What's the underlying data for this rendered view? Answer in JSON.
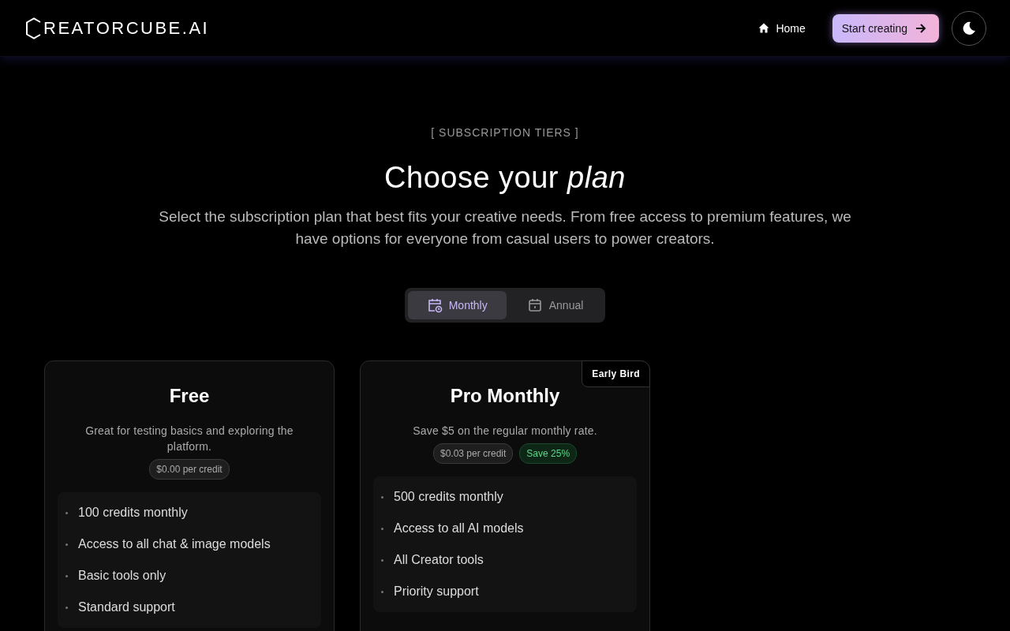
{
  "header": {
    "logo": "REATORCUBE.AI",
    "nav": [
      {
        "label": "Home"
      }
    ],
    "cta": "Start creating"
  },
  "hero": {
    "eyebrow": "[ SUBSCRIPTION TIERS ]",
    "title": "Choose your",
    "title_em": "plan",
    "subtitle": "Select the subscription plan that best fits your creative needs. From free access to premium features, we have options for everyone from casual users to power creators."
  },
  "billing_tabs": [
    {
      "label": "Monthly",
      "selected": true
    },
    {
      "label": "Annual",
      "selected": false
    }
  ],
  "plans": [
    {
      "name": "Free",
      "description": "Great for testing basics and exploring the platform.",
      "price": "$0.00 per credit",
      "features": [
        "100 credits monthly",
        "Access to all chat & image models",
        "Basic tools only",
        "Standard support"
      ]
    },
    {
      "name": "Pro Monthly",
      "badge": "Early Bird",
      "description": "Save $5 on the regular monthly rate.",
      "price": "$0.03 per credit",
      "savings": "Save 25%",
      "features": [
        "500 credits monthly",
        "Access to all AI models",
        "All Creator tools",
        "Priority support"
      ]
    }
  ]
}
